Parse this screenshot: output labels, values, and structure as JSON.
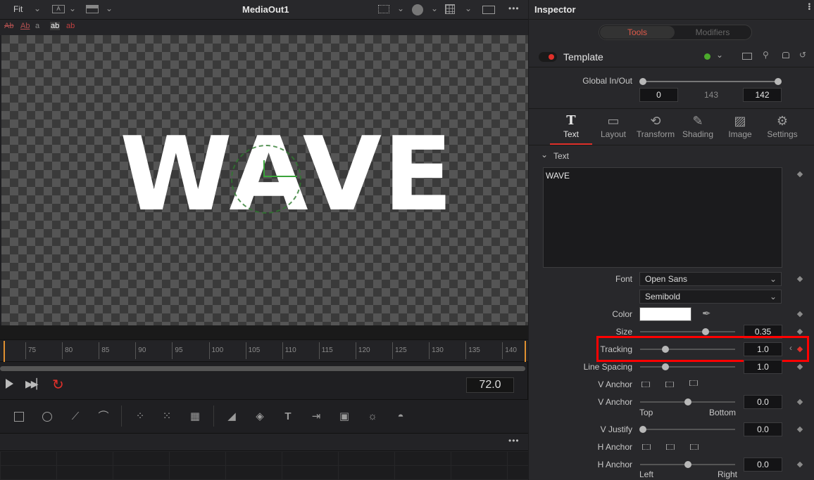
{
  "viewer": {
    "fit_label": "Fit",
    "title": "MediaOut1",
    "overlay_text": "WAVE",
    "timeline_ticks": [
      "75",
      "80",
      "85",
      "90",
      "95",
      "100",
      "105",
      "110",
      "115",
      "120",
      "125",
      "130",
      "135",
      "140"
    ],
    "current_frame": "72.0",
    "more_icon": "ellipsis-icon"
  },
  "inspector": {
    "title": "Inspector",
    "tabs_top": [
      "Tools",
      "Modifiers"
    ],
    "node_name": "Template",
    "global_inout_label": "Global In/Out",
    "global_in": "0",
    "global_mid": "143",
    "global_out": "142",
    "tool_tabs": [
      "Text",
      "Layout",
      "Transform",
      "Shading",
      "Image",
      "Settings"
    ],
    "section_title": "Text",
    "styled_text": "WAVE",
    "font_label": "Font",
    "font_family": "Open Sans",
    "font_style": "Semibold",
    "color_label": "Color",
    "size_label": "Size",
    "size_value": "0.35",
    "tracking_label": "Tracking",
    "tracking_value": "1.0",
    "line_spacing_label": "Line Spacing",
    "line_spacing_value": "1.0",
    "v_anchor_label": "V Anchor",
    "v_anchor_label2": "V Anchor",
    "v_anchor_value": "0.0",
    "top_label": "Top",
    "bottom_label": "Bottom",
    "v_justify_label": "V Justify",
    "v_justify_value": "0.0",
    "h_anchor_label": "H Anchor",
    "h_anchor_label2": "H Anchor",
    "h_anchor_value": "0.0",
    "left_label": "Left",
    "right_label": "Right"
  },
  "colors": {
    "accent_red": "#e0302a",
    "highlight_box": "#ff0000",
    "active_tab_text": "#e05a4a"
  }
}
